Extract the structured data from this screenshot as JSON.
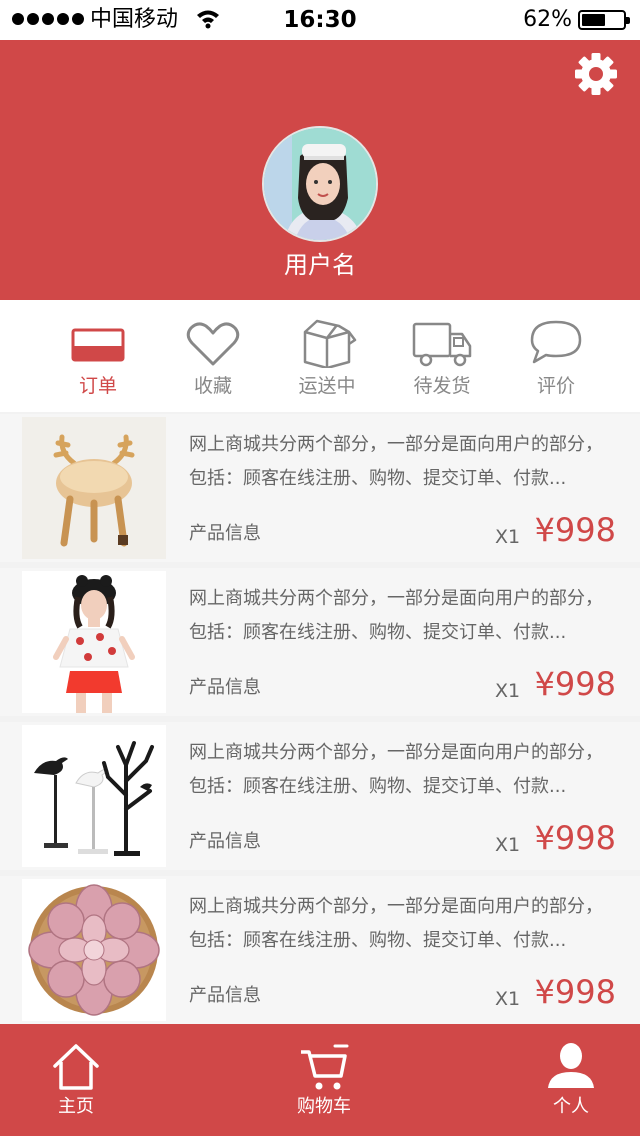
{
  "status_bar": {
    "carrier": "中国移动",
    "time": "16:30",
    "battery": "62%",
    "battery_level": 0.62
  },
  "header": {
    "username": "用户名",
    "settings_icon": "gear-icon"
  },
  "tabs": [
    {
      "label": "订单",
      "icon": "card-icon",
      "active": true
    },
    {
      "label": "收藏",
      "icon": "heart-icon",
      "active": false
    },
    {
      "label": "运送中",
      "icon": "box-icon",
      "active": false
    },
    {
      "label": "待发货",
      "icon": "truck-icon",
      "active": false
    },
    {
      "label": "评价",
      "icon": "chat-bubble-icon",
      "active": false
    }
  ],
  "products": [
    {
      "thumb": "deer-antler-stool-image",
      "desc_line1": "网上商城共分两个部分，一部分是面向用户的部分，",
      "desc_line2": "包括：顾客在线注册、购物、提交订单、付款...",
      "info_label": "产品信息",
      "qty": "X1",
      "price": "¥998"
    },
    {
      "thumb": "girl-outfit-image",
      "desc_line1": "网上商城共分两个部分，一部分是面向用户的部分，",
      "desc_line2": "包括：顾客在线注册、购物、提交订单、付款...",
      "info_label": "产品信息",
      "qty": "X1",
      "price": "¥998"
    },
    {
      "thumb": "bird-tree-decor-image",
      "desc_line1": "网上商城共分两个部分，一部分是面向用户的部分，",
      "desc_line2": "包括：顾客在线注册、购物、提交订单、付款...",
      "info_label": "产品信息",
      "qty": "X1",
      "price": "¥998"
    },
    {
      "thumb": "succulent-plant-image",
      "desc_line1": "网上商城共分两个部分，一部分是面向用户的部分，",
      "desc_line2": "包括：顾客在线注册、购物、提交订单、付款...",
      "info_label": "产品信息",
      "qty": "X1",
      "price": "¥998"
    }
  ],
  "bottom_nav": [
    {
      "label": "主页",
      "icon": "home-icon"
    },
    {
      "label": "购物车",
      "icon": "cart-icon"
    },
    {
      "label": "个人",
      "icon": "person-icon"
    }
  ],
  "colors": {
    "brand_red": "#d04848",
    "text_gray": "#666666",
    "tab_gray": "#888888",
    "list_bg": "#f6f6f6"
  }
}
